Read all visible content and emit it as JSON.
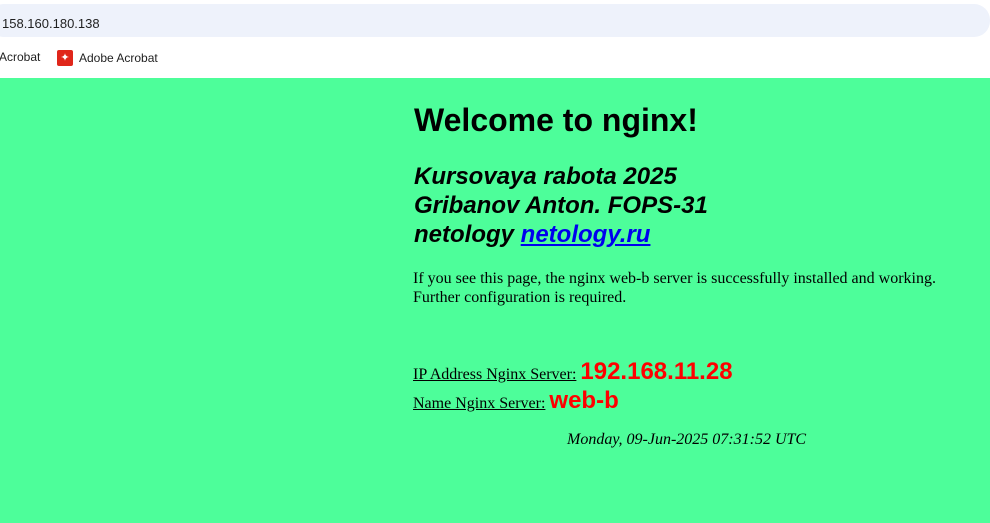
{
  "browser": {
    "url": "158.160.180.138",
    "bookmarks": [
      {
        "label": "Acrobat",
        "icon": "adobe-pdf-icon"
      },
      {
        "label": "Adobe Acrobat",
        "icon": "adobe-pdf-icon"
      }
    ]
  },
  "page": {
    "background": "#4dfe9a",
    "heading": "Welcome to nginx!",
    "subtitle": {
      "line1": "Kursovaya rabota 2025",
      "line2": "Gribanov Anton. FOPS-31",
      "line3_prefix": "netology ",
      "link_text": "netology.ru"
    },
    "description": "If you see this page, the nginx web-b server is successfully installed and working. Further configuration is required.",
    "ip": {
      "label": "IP Address Nginx Server:",
      "value": "192.168.11.28"
    },
    "name": {
      "label": "Name Nginx Server:",
      "value": "web-b"
    },
    "timestamp": "Monday, 09-Jun-2025 07:31:52 UTC",
    "accent_color": "#ff0000",
    "link_color": "#0000ee"
  }
}
